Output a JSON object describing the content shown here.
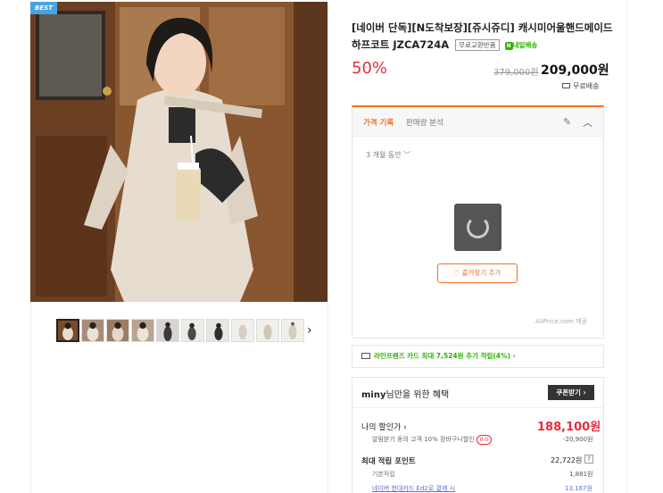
{
  "gallery": {
    "best_badge": "BEST",
    "thumbnail_count": 10,
    "next_arrow": "›"
  },
  "product": {
    "title": "[네이버 단독][N도착보장][쥬시쥬디] 캐시미어울핸드메이드하프코트 JZCA724A",
    "badge_free_exchange": "무료교환반품",
    "badge_nday": "내일배송",
    "badge_nday_mark": "N",
    "discount": "50%",
    "original_price": "379,000원",
    "price": "209,000원",
    "shipping": "무료배송"
  },
  "price_history": {
    "tab_active": "가격 기록",
    "tab_inactive": "판매량 분석",
    "period": "3 개월 동안 ﹀",
    "favorite_button": "♡ 즐겨찾기 추가",
    "credit": "AliPrice.com 제공"
  },
  "card_promo": {
    "text": "라인프렌즈 카드 최대 7,524원 추가 적립(4%) ›"
  },
  "benefit": {
    "user": "miny",
    "title_suffix": "님만을 위한 혜택",
    "coupon_button": "쿠폰받기 ›",
    "my_discount_label": "나의 할인가 ›",
    "my_discount_price": "188,100원",
    "sub_discount_label": "알림받기 동의 고객 10% 장바구니할인",
    "sub_discount_tag": "0-5",
    "sub_discount_value": "-20,900원",
    "max_points_label": "최대 적립 포인트",
    "max_points_value": "22,722원",
    "help": "?",
    "base_points_label": "기본적립",
    "base_points_value": "1,881원",
    "card_points_label": "네이버 현대카드 Ed2로 결제 시",
    "card_points_value": "13,167원"
  }
}
